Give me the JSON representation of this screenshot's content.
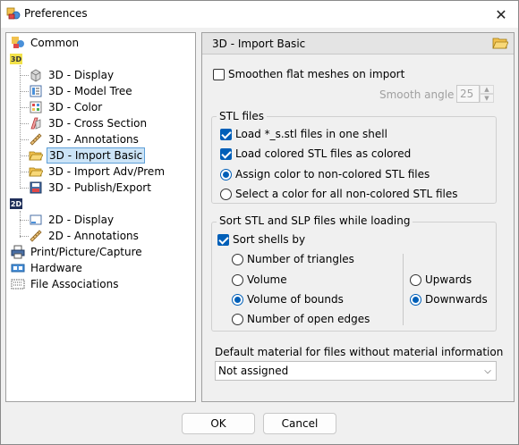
{
  "window": {
    "title": "Preferences",
    "close_glyph": "✕"
  },
  "tree": {
    "items": [
      {
        "label": "Common"
      },
      {
        "label": "3D - Display"
      },
      {
        "label": "3D - Model Tree"
      },
      {
        "label": "3D - Color"
      },
      {
        "label": "3D - Cross Section"
      },
      {
        "label": "3D - Annotations"
      },
      {
        "label": "3D - Import Basic",
        "selected": true
      },
      {
        "label": "3D - Import Adv/Prem"
      },
      {
        "label": "3D - Publish/Export"
      },
      {
        "label": "2D - Display"
      },
      {
        "label": "2D - Annotations"
      },
      {
        "label": "Print/Picture/Capture"
      },
      {
        "label": "Hardware"
      },
      {
        "label": "File Associations"
      }
    ],
    "group_3d": "3D",
    "group_2d": "2D"
  },
  "panel": {
    "title": "3D - Import Basic",
    "smoothen": {
      "label": "Smoothen flat meshes on import",
      "checked": false
    },
    "smooth_angle": {
      "label": "Smooth angle",
      "value": "25"
    },
    "stl": {
      "title": "STL files",
      "load_shell": {
        "label": "Load *_s.stl files in one shell",
        "checked": true
      },
      "load_colored": {
        "label": "Load colored STL files as colored",
        "checked": true
      },
      "assign_color": {
        "label": "Assign color to non-colored STL files",
        "selected": true
      },
      "select_color": {
        "label": "Select a color for all non-colored STL files",
        "selected": false
      }
    },
    "sort": {
      "title": "Sort  STL and SLP files while loading",
      "sort_shells": {
        "label": "Sort shells by",
        "checked": true
      },
      "criteria": [
        {
          "label": "Number of triangles",
          "selected": false
        },
        {
          "label": "Volume",
          "selected": false
        },
        {
          "label": "Volume of bounds",
          "selected": true
        },
        {
          "label": "Number of open edges",
          "selected": false
        }
      ],
      "order": [
        {
          "label": "Upwards",
          "selected": false
        },
        {
          "label": "Downwards",
          "selected": true
        }
      ]
    },
    "material": {
      "label": "Default material for files without material information",
      "value": "Not assigned"
    }
  },
  "footer": {
    "ok_label": "OK",
    "cancel_label": "Cancel"
  },
  "colors": {
    "accent": "#005fb8",
    "selection_bg": "#cce4f7",
    "window_bg": "#f0f0f0"
  }
}
